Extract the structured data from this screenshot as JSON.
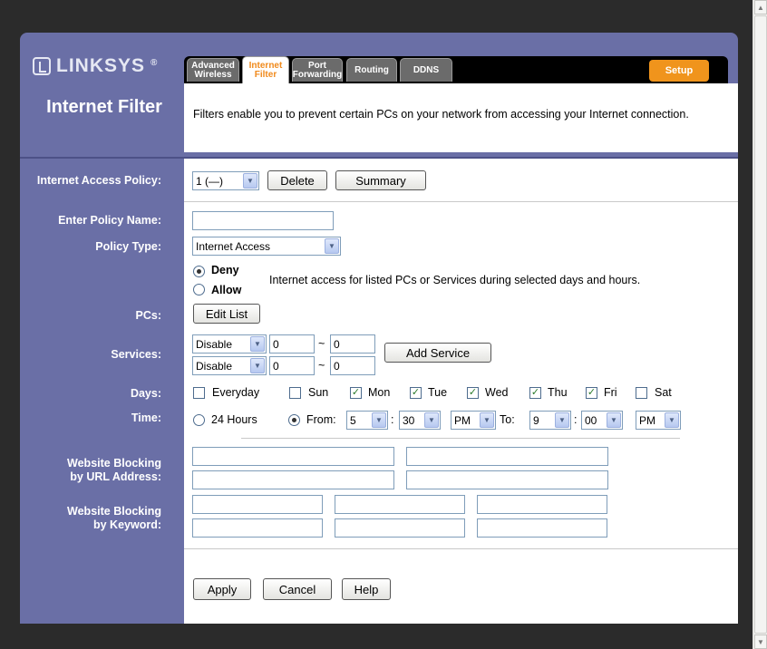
{
  "brand": {
    "logo": "LINKSYS",
    "reg": "®"
  },
  "tabs": [
    {
      "label": "Advanced Wireless"
    },
    {
      "label": "Internet Filter"
    },
    {
      "label": "Port Forwarding"
    },
    {
      "label": "Routing"
    },
    {
      "label": "DDNS"
    }
  ],
  "setup_label": "Setup",
  "page_title": "Internet Filter",
  "description": "Filters enable you to prevent certain PCs on your network from accessing your Internet connection.",
  "labels": {
    "access_policy": "Internet Access Policy:",
    "policy_name": "Enter Policy Name:",
    "policy_type": "Policy Type:",
    "pcs": "PCs:",
    "services": "Services:",
    "days": "Days:",
    "time": "Time:",
    "url_block_1": "Website Blocking",
    "url_block_2": "by URL Address:",
    "kw_block_1": "Website Blocking",
    "kw_block_2": "by Keyword:"
  },
  "policy": {
    "selected": "1 (—)",
    "delete": "Delete",
    "summary": "Summary"
  },
  "policy_name_value": "",
  "policy_type_value": "Internet Access",
  "mode": {
    "deny": "Deny",
    "allow": "Allow",
    "selected": "deny",
    "note": "Internet access for listed PCs or Services during selected days and hours."
  },
  "edit_list": "Edit List",
  "services": [
    {
      "select": "Disable",
      "from": "0",
      "to": "0"
    },
    {
      "select": "Disable",
      "from": "0",
      "to": "0"
    }
  ],
  "range_sep": "~",
  "add_service": "Add Service",
  "days": [
    {
      "label": "Everyday",
      "checked": false
    },
    {
      "label": "Sun",
      "checked": false
    },
    {
      "label": "Mon",
      "checked": true
    },
    {
      "label": "Tue",
      "checked": true
    },
    {
      "label": "Wed",
      "checked": true
    },
    {
      "label": "Thu",
      "checked": true
    },
    {
      "label": "Fri",
      "checked": true
    },
    {
      "label": "Sat",
      "checked": false
    }
  ],
  "time": {
    "hours24": "24 Hours",
    "from_label": "From:",
    "to_label": "To:",
    "colon": ":",
    "selected": "from",
    "from_hour": "5",
    "from_min": "30",
    "from_ampm": "PM",
    "to_hour": "9",
    "to_min": "00",
    "to_ampm": "PM"
  },
  "buttons": {
    "apply": "Apply",
    "cancel": "Cancel",
    "help": "Help"
  },
  "colors": {
    "panel": "#6a6fa6",
    "tab_active_text": "#f08a1c",
    "setup": "#f0941c"
  }
}
